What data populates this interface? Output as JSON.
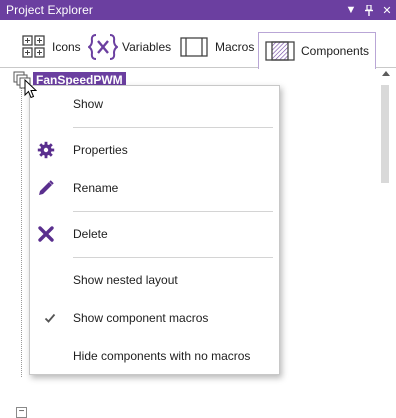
{
  "window": {
    "title": "Project Explorer",
    "buttons": [
      "dropdown-icon",
      "pin-icon",
      "close-icon"
    ]
  },
  "tabs": [
    {
      "label": "Icons",
      "icon": "icons-grid-icon"
    },
    {
      "label": "Variables",
      "icon": "variables-brace-icon"
    },
    {
      "label": "Macros",
      "icon": "macros-icon"
    },
    {
      "label": "Components",
      "icon": "components-icon",
      "active": true
    }
  ],
  "tree": {
    "root_label": "FanSpeedPWM",
    "expander_glyph": "−"
  },
  "context_menu": {
    "items": [
      {
        "label": "Show",
        "icon": null
      },
      {
        "label": "Properties",
        "icon": "gear-icon"
      },
      {
        "label": "Rename",
        "icon": "pencil-icon"
      },
      {
        "label": "Delete",
        "icon": "x-icon"
      },
      {
        "label": "Show nested layout",
        "icon": null
      },
      {
        "label": "Show component macros",
        "icon": "checkmark-icon",
        "checked": true
      },
      {
        "label": "Hide components with no macros",
        "icon": null
      }
    ]
  },
  "colors": {
    "accent": "#6b3fa0",
    "icon_purple": "#6b3fa0",
    "menu_icon": "#5a2f8e"
  }
}
